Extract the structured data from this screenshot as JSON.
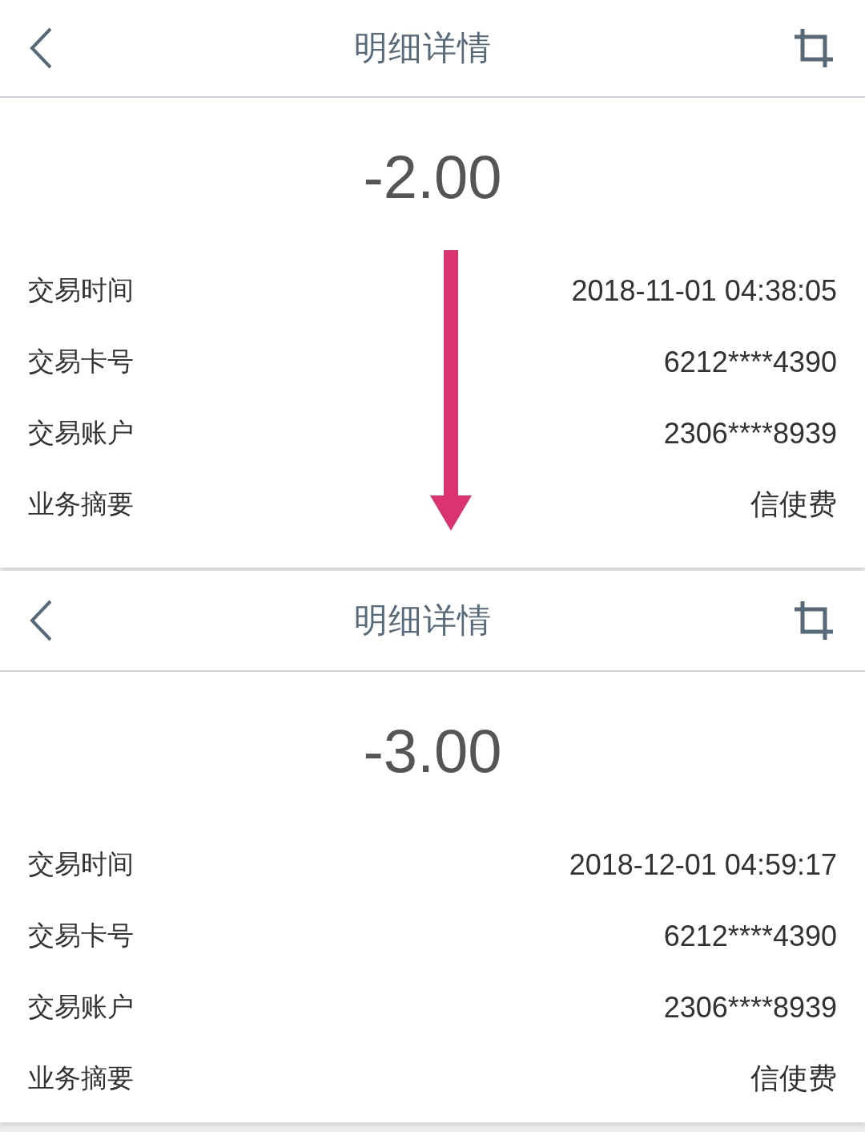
{
  "panels": [
    {
      "title": "明细详情",
      "amount": "-2.00",
      "rows": [
        {
          "label": "交易时间",
          "value": "2018-11-01 04:38:05"
        },
        {
          "label": "交易卡号",
          "value": "6212****4390"
        },
        {
          "label": "交易账户",
          "value": "2306****8939"
        },
        {
          "label": "业务摘要",
          "value": "信使费"
        }
      ]
    },
    {
      "title": "明细详情",
      "amount": "-3.00",
      "rows": [
        {
          "label": "交易时间",
          "value": "2018-12-01 04:59:17"
        },
        {
          "label": "交易卡号",
          "value": "6212****4390"
        },
        {
          "label": "交易账户",
          "value": "2306****8939"
        },
        {
          "label": "业务摘要",
          "value": "信使费"
        }
      ]
    }
  ]
}
